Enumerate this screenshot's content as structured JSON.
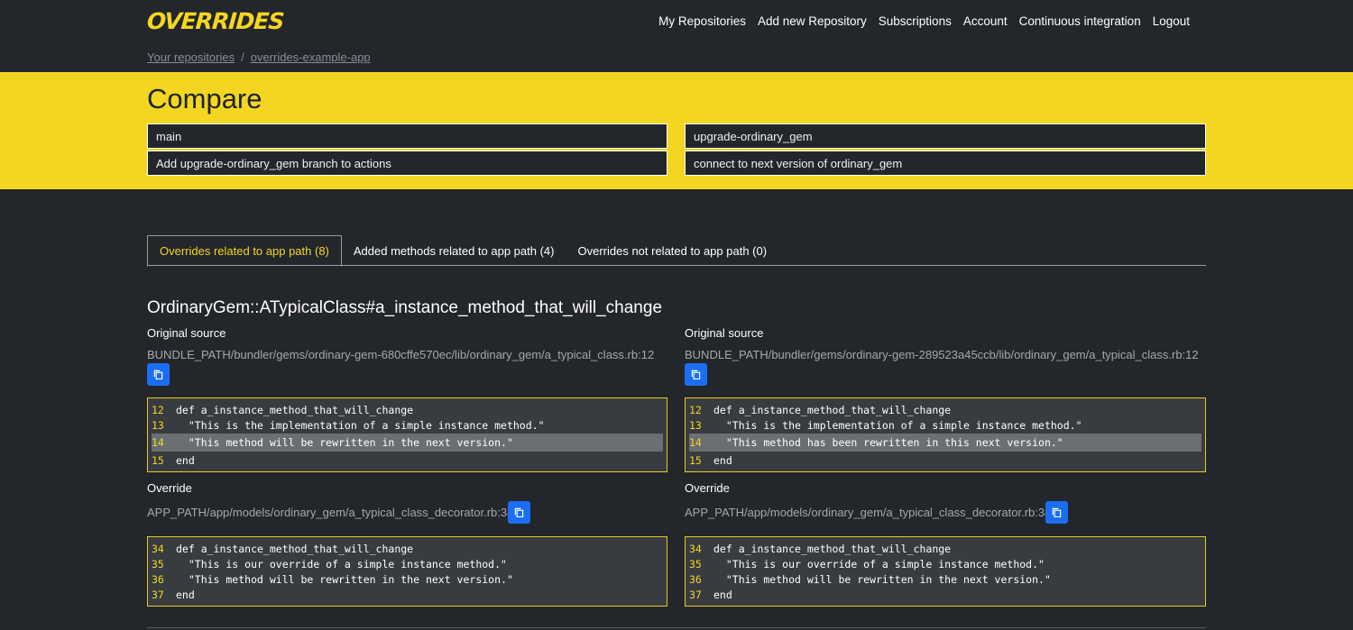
{
  "brand": {
    "logo": "OVERRIDES"
  },
  "nav": {
    "links": [
      "My Repositories",
      "Add new Repository",
      "Subscriptions",
      "Account",
      "Continuous integration",
      "Logout"
    ]
  },
  "breadcrumb": {
    "items": [
      "Your repositories",
      "overrides-example-app"
    ],
    "separator": "/"
  },
  "compare": {
    "title": "Compare",
    "left": {
      "branch": "main",
      "commit": "Add upgrade-ordinary_gem branch to actions"
    },
    "right": {
      "branch": "upgrade-ordinary_gem",
      "commit": "connect to next version of ordinary_gem"
    }
  },
  "tabs": [
    "Overrides related to app path (8)",
    "Added methods related to app path (4)",
    "Overrides not related to app path (0)"
  ],
  "method": {
    "title": "OrdinaryGem::ATypicalClass#a_instance_method_that_will_change",
    "left": {
      "original_label": "Original source",
      "original_path": "BUNDLE_PATH/bundler/gems/ordinary-gem-680cffe570ec/lib/ordinary_gem/a_typical_class.rb:12",
      "original_code": [
        {
          "n": "12",
          "t": "def a_instance_method_that_will_change"
        },
        {
          "n": "13",
          "t": "  \"This is the implementation of a simple instance method.\""
        },
        {
          "n": "14",
          "t": "  \"This method will be rewritten in the next version.\""
        },
        {
          "n": "15",
          "t": "end"
        }
      ],
      "override_label": "Override",
      "override_path": "APP_PATH/app/models/ordinary_gem/a_typical_class_decorator.rb:34",
      "override_code": [
        {
          "n": "34",
          "t": "def a_instance_method_that_will_change"
        },
        {
          "n": "35",
          "t": "  \"This is our override of a simple instance method.\""
        },
        {
          "n": "36",
          "t": "  \"This method will be rewritten in the next version.\""
        },
        {
          "n": "37",
          "t": "end"
        }
      ]
    },
    "right": {
      "original_label": "Original source",
      "original_path": "BUNDLE_PATH/bundler/gems/ordinary-gem-289523a45ccb/lib/ordinary_gem/a_typical_class.rb:12",
      "original_code": [
        {
          "n": "12",
          "t": "def a_instance_method_that_will_change"
        },
        {
          "n": "13",
          "t": "  \"This is the implementation of a simple instance method.\""
        },
        {
          "n": "14",
          "t": "  \"This method has been rewritten in this next version.\""
        },
        {
          "n": "15",
          "t": "end"
        }
      ],
      "override_label": "Override",
      "override_path": "APP_PATH/app/models/ordinary_gem/a_typical_class_decorator.rb:34",
      "override_code": [
        {
          "n": "34",
          "t": "def a_instance_method_that_will_change"
        },
        {
          "n": "35",
          "t": "  \"This is our override of a simple instance method.\""
        },
        {
          "n": "36",
          "t": "  \"This method will be rewritten in the next version.\""
        },
        {
          "n": "37",
          "t": "end"
        }
      ]
    }
  },
  "colors": {
    "accent": "#f2d621",
    "background": "#23262b",
    "button": "#1b6ef3"
  },
  "icons": {
    "copy": "copy-icon"
  }
}
